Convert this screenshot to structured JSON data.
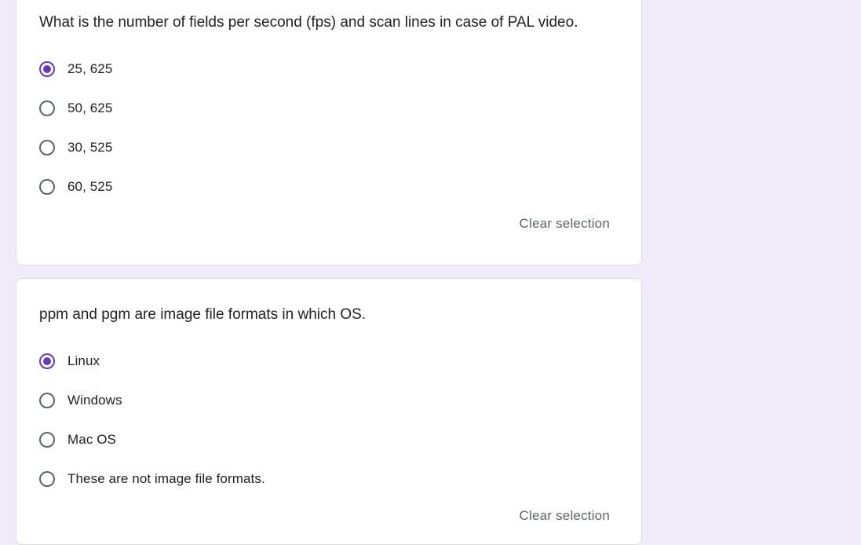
{
  "questions": [
    {
      "text": "What is the number of fields per second (fps) and scan lines in case of PAL video.",
      "options": [
        "25, 625",
        "50, 625",
        "30, 525",
        "60, 525"
      ],
      "selected_index": 0,
      "clear_label": "Clear selection"
    },
    {
      "text": "ppm and pgm are image file formats in which OS.",
      "options": [
        "Linux",
        "Windows",
        "Mac OS",
        "These are not image file formats."
      ],
      "selected_index": 0,
      "clear_label": "Clear selection"
    }
  ],
  "colors": {
    "background": "#f0ebf8",
    "accent": "#673ab7",
    "card": "#ffffff",
    "text": "#202124",
    "secondary_text": "#5f6368"
  }
}
